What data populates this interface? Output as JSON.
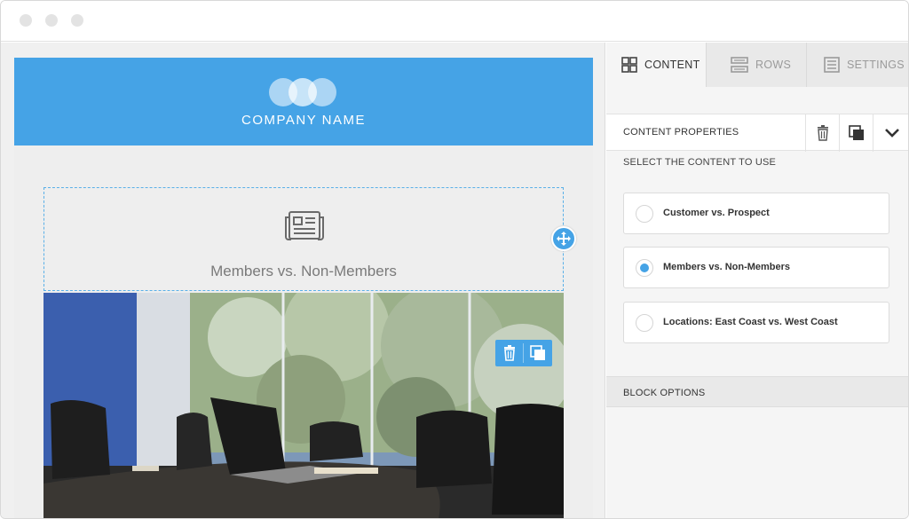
{
  "email": {
    "company_name": "COMPANY NAME",
    "dynamic_block_title": "Members vs. Non-Members"
  },
  "sidebar": {
    "tabs": [
      {
        "label": "CONTENT",
        "icon": "grid-icon",
        "active": true
      },
      {
        "label": "ROWS",
        "icon": "rows-icon",
        "active": false
      },
      {
        "label": "SETTINGS",
        "icon": "settings-icon",
        "active": false
      }
    ],
    "properties_title": "CONTENT PROPERTIES",
    "select_label": "SELECT THE CONTENT TO USE",
    "options": [
      {
        "label": "Customer vs. Prospect",
        "selected": false
      },
      {
        "label": "Members vs. Non-Members",
        "selected": true
      },
      {
        "label": "Locations: East Coast vs. West Coast",
        "selected": false
      }
    ],
    "block_options_label": "BLOCK OPTIONS"
  },
  "colors": {
    "accent": "#45a3e6",
    "header_bg": "#45a3e6",
    "sidebar_bg": "#f5f5f5"
  }
}
